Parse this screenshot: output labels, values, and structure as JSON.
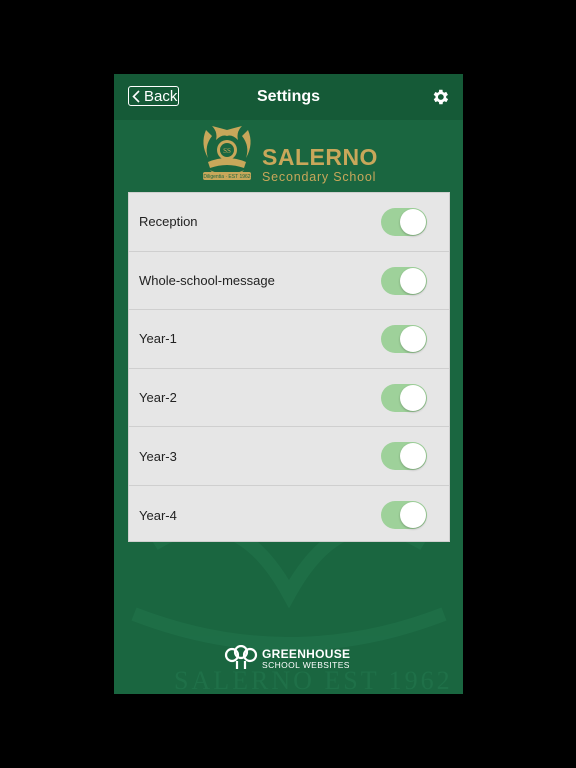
{
  "navbar": {
    "back_label": "Back",
    "title": "Settings",
    "icons": {
      "back": "chevron-left-icon",
      "settings": "gear-icon"
    }
  },
  "school": {
    "name": "SALERNO",
    "subtitle": "Secondary School",
    "crest_text": "Diligentia · EST 1962",
    "brand_color": "#c8a75a"
  },
  "settings": {
    "items": [
      {
        "label": "Reception",
        "enabled": true
      },
      {
        "label": "Whole-school-message",
        "enabled": true
      },
      {
        "label": "Year-1",
        "enabled": true
      },
      {
        "label": "Year-2",
        "enabled": true
      },
      {
        "label": "Year-3",
        "enabled": true
      },
      {
        "label": "Year-4",
        "enabled": true
      }
    ]
  },
  "footer": {
    "line1": "GREENHOUSE",
    "line2": "SCHOOL WEBSITES"
  },
  "colors": {
    "background": "#1a6640",
    "navbar": "#155a37",
    "toggle_on": "#9ed19a",
    "list_bg": "#e6e6e6"
  }
}
